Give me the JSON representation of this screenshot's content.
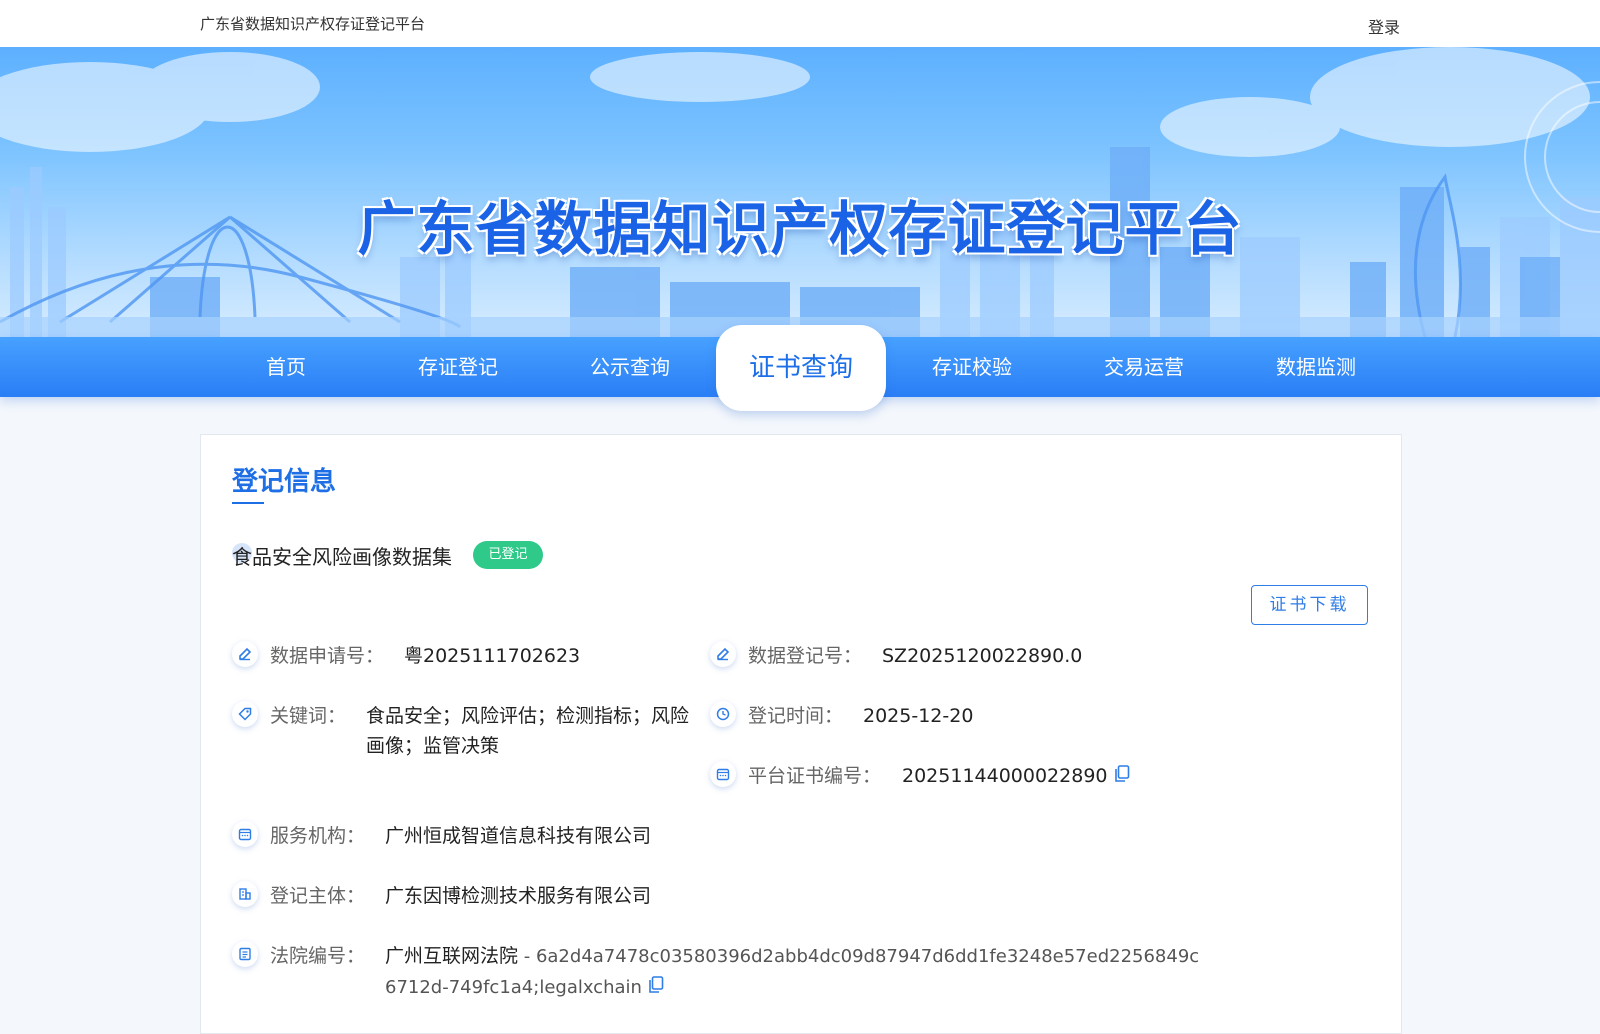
{
  "header": {
    "site_name": "广东省数据知识产权存证登记平台",
    "login": "登录"
  },
  "banner": {
    "title": "广东省数据知识产权存证登记平台"
  },
  "nav": {
    "items": [
      {
        "label": "首页"
      },
      {
        "label": "存证登记"
      },
      {
        "label": "公示查询"
      },
      {
        "label": "证书查询",
        "active": true
      },
      {
        "label": "存证校验"
      },
      {
        "label": "交易运营"
      },
      {
        "label": "数据监测"
      }
    ]
  },
  "section": {
    "title": "登记信息",
    "dataset_name": "食品安全风险画像数据集",
    "status": "已登记",
    "download": "证书下载"
  },
  "fields": {
    "application_no": {
      "label": "数据申请号：",
      "value": "粤2025111702623"
    },
    "registration_no": {
      "label": "数据登记号：",
      "value": "SZ2025120022890.0"
    },
    "keywords": {
      "label": "关键词：",
      "value": "食品安全；风险评估；检测指标；风险画像；监管决策"
    },
    "registration_time": {
      "label": "登记时间：",
      "value": "2025-12-20"
    },
    "certificate_no": {
      "label": "平台证书编号：",
      "value": "20251144000022890"
    },
    "service_org": {
      "label": "服务机构：",
      "value": "广州恒成智道信息科技有限公司"
    },
    "registrant": {
      "label": "登记主体：",
      "value": "广东因博检测技术服务有限公司"
    },
    "court_no": {
      "label": "法院编号：",
      "court": "广州互联网法院",
      "hash": " - 6a2d4a7478c03580396d2abb4dc09d87947d6dd1fe3248e57ed2256849c6712d-749fc1a4;legalxchain"
    }
  },
  "colors": {
    "primary": "#1e6fe6",
    "nav_bg": "#2a7ef6",
    "badge_green": "#2fc98a"
  }
}
